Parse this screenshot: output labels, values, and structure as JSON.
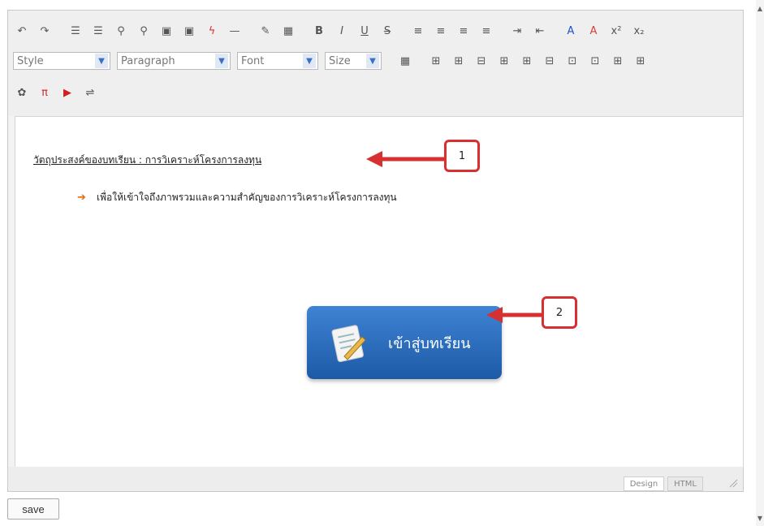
{
  "toolbar": {
    "row1_icons": [
      "undo-icon",
      "redo-icon",
      "ordered-list-icon",
      "unordered-list-icon",
      "find-icon",
      "replace-icon",
      "image-icon",
      "media-icon",
      "flash-icon",
      "horizontal-rule-icon",
      "edit-icon",
      "table-icon",
      "bold-icon",
      "italic-icon",
      "underline-icon",
      "strikethrough-icon",
      "align-left-icon",
      "align-center-icon",
      "align-right-icon",
      "justify-icon",
      "indent-icon",
      "outdent-icon",
      "text-color-icon",
      "highlight-color-icon",
      "superscript-icon",
      "subscript-icon"
    ],
    "row1_glyphs": [
      "↶",
      "↷",
      "☰",
      "☰",
      "⚲",
      "⚲",
      "▣",
      "▣",
      "ϟ",
      "—",
      "✎",
      "▦",
      "B",
      "I",
      "U",
      "S",
      "≡",
      "≡",
      "≡",
      "≡",
      "⇥",
      "⇤",
      "A",
      "A",
      "x²",
      "x₂"
    ],
    "style_select": "Style",
    "paragraph_select": "Paragraph",
    "font_select": "Font",
    "size_select": "Size",
    "row2_icons": [
      "insert-table-icon",
      "insert-row-before-icon",
      "insert-row-after-icon",
      "delete-row-icon",
      "insert-col-before-icon",
      "insert-col-after-icon",
      "delete-col-icon",
      "merge-cells-icon",
      "split-cells-icon",
      "cell-props-icon",
      "row-props-icon"
    ],
    "row2_glyphs": [
      "▦",
      "⊞",
      "⊞",
      "⊟",
      "⊞",
      "⊞",
      "⊟",
      "⊡",
      "⊡",
      "⊞",
      "⊞"
    ],
    "row3_icons": [
      "special-char-icon",
      "pi-icon",
      "youtube-icon",
      "page-break-icon"
    ],
    "row3_glyphs": [
      "✿",
      "π",
      "▶",
      "⇌"
    ]
  },
  "content": {
    "heading": "วัตถุประสงค์ของบทเรียน : การวิเคราะห์โครงการลงทุน",
    "bullet_text": "เพื่อให้เข้าใจถึงภาพรวมและความสำคัญของการวิเคราะห์โครงการลงทุน",
    "enter_button_label": "เข้าสู่บทเรียน"
  },
  "callouts": {
    "first": "1",
    "second": "2"
  },
  "footer": {
    "design_tab": "Design",
    "html_tab": "HTML",
    "save_button": "save"
  },
  "colors": {
    "accent_red": "#d63030",
    "button_blue": "#2a6dbf"
  }
}
